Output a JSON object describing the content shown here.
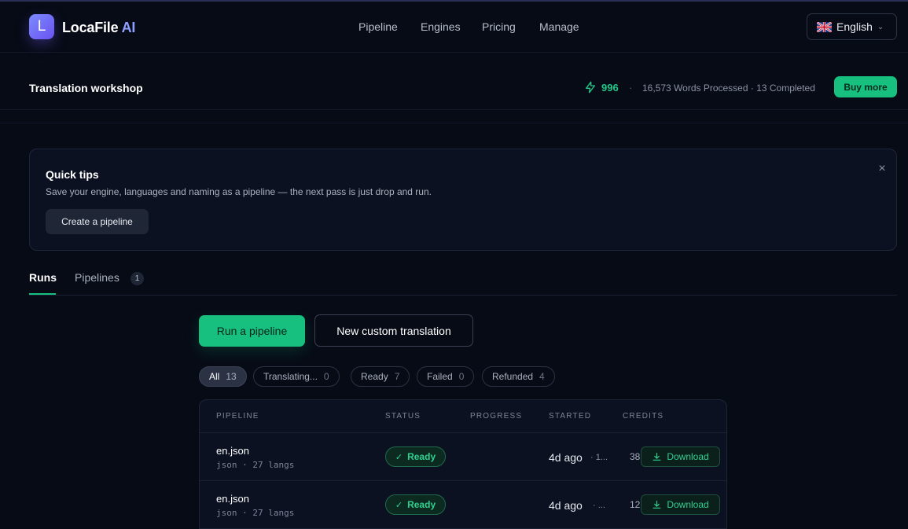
{
  "header": {
    "logo_letter": "L",
    "brand_main": "LocaFile",
    "brand_ai": "AI",
    "nav": [
      "Pipeline",
      "Engines",
      "Pricing",
      "Manage"
    ],
    "language": "English"
  },
  "subheader": {
    "title": "Translation workshop",
    "credits": "996",
    "separator": "·",
    "stats": "16,573 Words Processed · 13 Completed",
    "buy_label": "Buy more"
  },
  "tips": {
    "title": "Quick tips",
    "text": "Save your engine, languages and naming as a pipeline — the next pass is just drop and run.",
    "button": "Create a pipeline",
    "close": "×"
  },
  "tabs": {
    "runs": "Runs",
    "pipelines": "Pipelines",
    "pipelines_count": "1"
  },
  "actions": {
    "run": "Run a pipeline",
    "custom": "New custom translation"
  },
  "filters": [
    {
      "label": "All",
      "count": "13"
    },
    {
      "label": "Translating...",
      "count": "0"
    },
    {
      "label": "Ready",
      "count": "7"
    },
    {
      "label": "Failed",
      "count": "0"
    },
    {
      "label": "Refunded",
      "count": "4"
    }
  ],
  "table": {
    "columns": [
      "PIPELINE",
      "STATUS",
      "PROGRESS",
      "STARTED",
      "CREDITS"
    ],
    "rows": [
      {
        "file": "en.json",
        "meta": "json · 27 langs",
        "status": "Ready",
        "started": "4d ago",
        "trail": "· 1...",
        "credits": "38",
        "action": "Download"
      },
      {
        "file": "en.json",
        "meta": "json · 27 langs",
        "status": "Ready",
        "started": "4d ago",
        "trail": "· ...",
        "credits": "12",
        "action": "Download"
      }
    ]
  },
  "colors": {
    "accent": "#18c07f",
    "background": "#070b16",
    "brand": "#6a52f0"
  }
}
